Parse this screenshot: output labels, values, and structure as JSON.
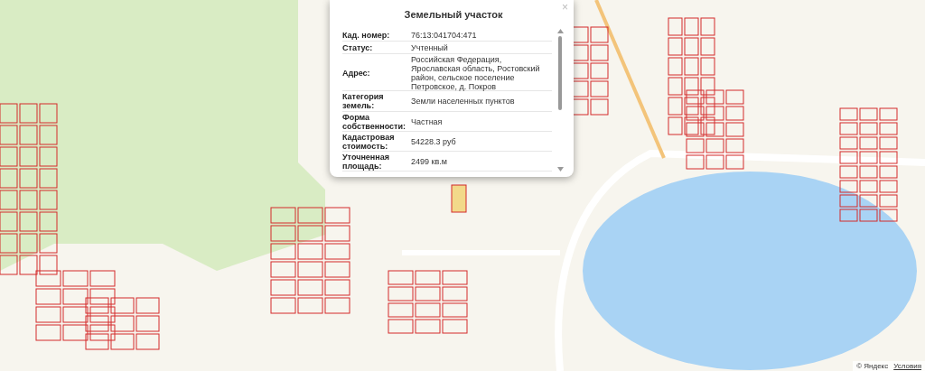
{
  "popup": {
    "title": "Земельный участок",
    "close": "×",
    "rows": [
      {
        "label": "Кад. номер:",
        "value": "76:13:041704:471"
      },
      {
        "label": "Статус:",
        "value": "Учтенный"
      },
      {
        "label": "Адрес:",
        "value": "Российская Федерация, Ярославская область, Ростовский район, сельское поселение Петровское, д. Покров"
      },
      {
        "label": "Категория земель:",
        "value": "Земли населенных пунктов"
      },
      {
        "label": "Форма собственности:",
        "value": "Частная"
      },
      {
        "label": "Кадастровая стоимость:",
        "value": "54228.3 руб"
      },
      {
        "label": "Уточненная площадь:",
        "value": "2499 кв.м"
      }
    ]
  },
  "attribution": {
    "copyright": "© Яндекс",
    "terms": "Условия"
  }
}
